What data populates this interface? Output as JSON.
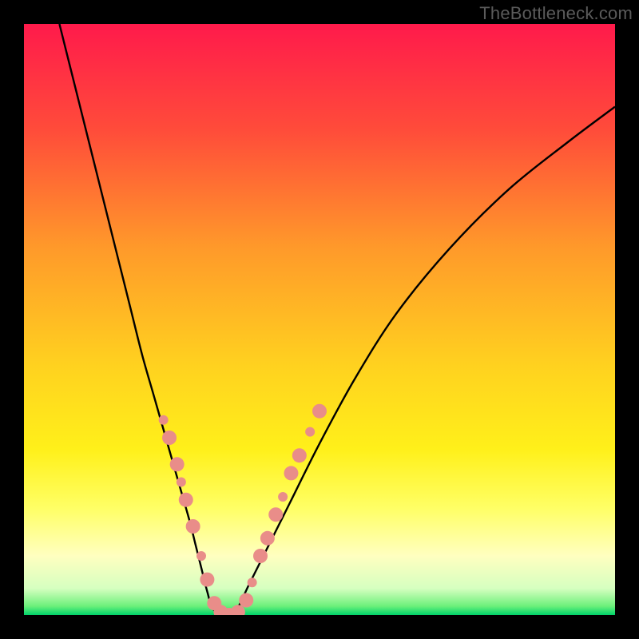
{
  "watermark": "TheBottleneck.com",
  "chart_data": {
    "type": "line",
    "title": "",
    "xlabel": "",
    "ylabel": "",
    "xlim": [
      0,
      100
    ],
    "ylim": [
      0,
      100
    ],
    "grid": false,
    "legend": false,
    "background_gradient": {
      "stops": [
        {
          "offset": 0.0,
          "color": "#ff1a4b"
        },
        {
          "offset": 0.18,
          "color": "#ff4c3a"
        },
        {
          "offset": 0.38,
          "color": "#ff9a2a"
        },
        {
          "offset": 0.58,
          "color": "#ffd21f"
        },
        {
          "offset": 0.72,
          "color": "#fff01a"
        },
        {
          "offset": 0.82,
          "color": "#ffff66"
        },
        {
          "offset": 0.9,
          "color": "#ffffc0"
        },
        {
          "offset": 0.955,
          "color": "#d6ffc0"
        },
        {
          "offset": 0.985,
          "color": "#6cf07a"
        },
        {
          "offset": 1.0,
          "color": "#00d36a"
        }
      ]
    },
    "curve": {
      "name": "bottleneck-curve",
      "x": [
        6,
        8,
        10,
        12,
        14,
        16,
        18,
        20,
        22,
        24,
        26,
        28,
        29,
        30,
        31,
        32,
        34,
        36,
        38,
        41,
        45,
        50,
        56,
        63,
        72,
        82,
        92,
        100
      ],
      "y": [
        100,
        92,
        84,
        76,
        68,
        60,
        52,
        44,
        37,
        30,
        23,
        16,
        12,
        8,
        4,
        1,
        0,
        1,
        5,
        11,
        19,
        29,
        40,
        51,
        62,
        72,
        80,
        86
      ]
    },
    "bead_markers": {
      "color": "#e98d89",
      "radius_small": 6,
      "radius_large": 9,
      "points": [
        {
          "x": 23.6,
          "y": 33.0,
          "r": 6
        },
        {
          "x": 24.6,
          "y": 30.0,
          "r": 9
        },
        {
          "x": 25.9,
          "y": 25.5,
          "r": 9
        },
        {
          "x": 26.6,
          "y": 22.5,
          "r": 6
        },
        {
          "x": 27.4,
          "y": 19.5,
          "r": 9
        },
        {
          "x": 28.6,
          "y": 15.0,
          "r": 9
        },
        {
          "x": 30.0,
          "y": 10.0,
          "r": 6
        },
        {
          "x": 31.0,
          "y": 6.0,
          "r": 9
        },
        {
          "x": 32.2,
          "y": 2.0,
          "r": 9
        },
        {
          "x": 33.3,
          "y": 0.5,
          "r": 9
        },
        {
          "x": 34.7,
          "y": 0.0,
          "r": 9
        },
        {
          "x": 36.2,
          "y": 0.5,
          "r": 9
        },
        {
          "x": 37.6,
          "y": 2.5,
          "r": 9
        },
        {
          "x": 38.6,
          "y": 5.5,
          "r": 6
        },
        {
          "x": 40.0,
          "y": 10.0,
          "r": 9
        },
        {
          "x": 41.2,
          "y": 13.0,
          "r": 9
        },
        {
          "x": 42.6,
          "y": 17.0,
          "r": 9
        },
        {
          "x": 43.8,
          "y": 20.0,
          "r": 6
        },
        {
          "x": 45.2,
          "y": 24.0,
          "r": 9
        },
        {
          "x": 46.6,
          "y": 27.0,
          "r": 9
        },
        {
          "x": 48.4,
          "y": 31.0,
          "r": 6
        },
        {
          "x": 50.0,
          "y": 34.5,
          "r": 9
        }
      ]
    }
  }
}
